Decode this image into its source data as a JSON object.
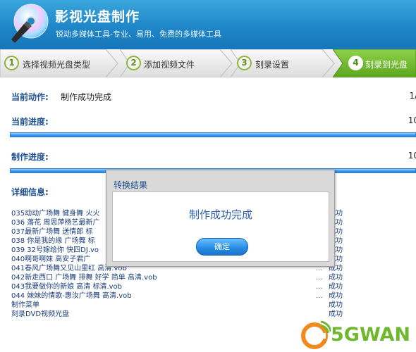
{
  "header": {
    "title": "影视光盘制作",
    "subtitle": "锐动多媒体工具-专业、易用、免费的多媒体工具"
  },
  "steps": [
    {
      "num": "1",
      "label": "选择视频光盘类型"
    },
    {
      "num": "2",
      "label": "添加视频文件"
    },
    {
      "num": "3",
      "label": "刻录设置"
    },
    {
      "num": "4",
      "label": "刻录到光盘"
    }
  ],
  "status": {
    "current_action_label": "当前动作:",
    "current_action_value": "制作成功完成",
    "current_action_count": "1/",
    "current_progress_label": "当前进度:",
    "current_progress_value": "10",
    "current_progress_fraction": 1.0,
    "make_progress_label": "制作进度:",
    "make_progress_value": "10",
    "make_progress_fraction": 1.0,
    "details_label": "详细信息:"
  },
  "details": [
    {
      "text": "035动动广场舞 健身舞 火火",
      "dots": "...",
      "status": "成功"
    },
    {
      "text": "036 落花 周思萍杨艺最新广",
      "dots": "...",
      "status": "成功"
    },
    {
      "text": "037最新广场舞 送情郎 标",
      "dots": "...",
      "status": "成功"
    },
    {
      "text": "038 你是我的缘 广场舞 标",
      "dots": "...",
      "status": "成功"
    },
    {
      "text": "039 32号嫁给你 快四DJ.vo",
      "dots": "...",
      "status": "成功"
    },
    {
      "text": "040啊哥啊妹 高安子君广",
      "dots": "...",
      "status": "成功"
    },
    {
      "text": "041春风广场舞又见山里红 高清.vob",
      "dots": "...",
      "status": "成功"
    },
    {
      "text": "042新走西口 广场舞 排舞 好学 简单 高清.vob",
      "dots": "...",
      "status": "成功"
    },
    {
      "text": "043我要做你的新娘 高清 标清.vob",
      "dots": "...",
      "status": "成功"
    },
    {
      "text": "044 妹妹的情歌-惠汝广场舞 高清.vob",
      "dots": "...",
      "status": "成功"
    },
    {
      "text": "制作菜单",
      "dots": "",
      "status": "成功"
    },
    {
      "text": "刻录DVD视频光盘",
      "dots": "",
      "status": "成功"
    }
  ],
  "dialog": {
    "title": "转换结果",
    "message": "制作成功完成",
    "ok_label": "确定"
  },
  "watermark": {
    "text": "5GWAN"
  }
}
